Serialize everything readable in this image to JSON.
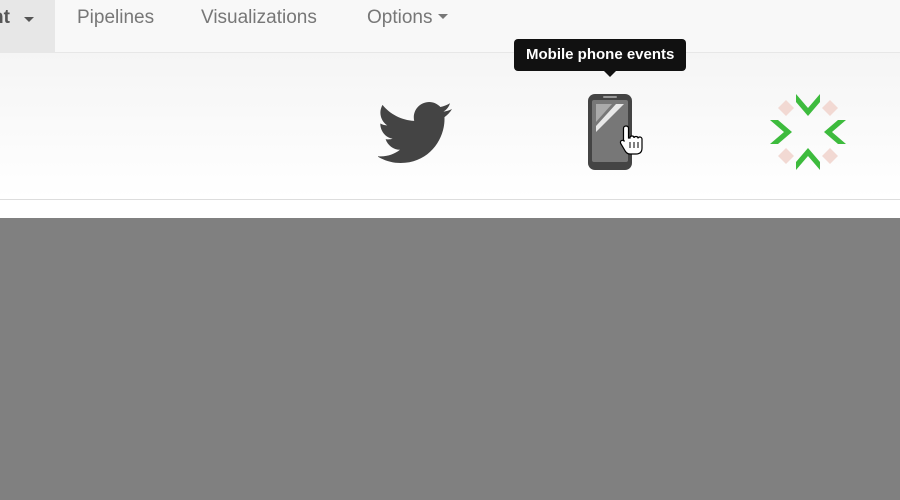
{
  "navbar": {
    "items": [
      {
        "label": "nt"
      },
      {
        "label": "Pipelines"
      },
      {
        "label": "Visualizations"
      },
      {
        "label": "Options"
      }
    ]
  },
  "tooltip": {
    "text": "Mobile phone events"
  },
  "icons": {
    "twitter": "twitter-bird-icon",
    "phone": "mobile-phone-icon",
    "arrows": "compress-arrows-icon"
  },
  "colors": {
    "icon_dark": "#444444",
    "icon_green": "#3dbb3d",
    "overlay": "#808080",
    "tooltip_bg": "#111111"
  }
}
